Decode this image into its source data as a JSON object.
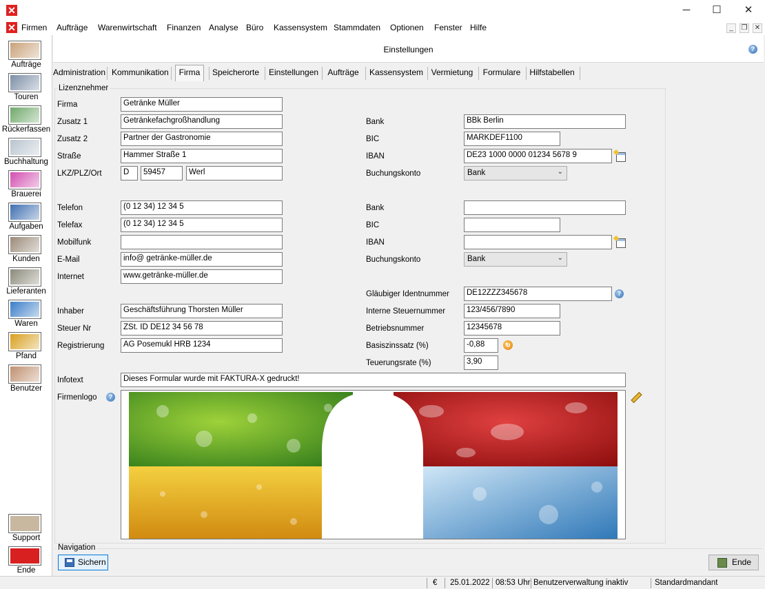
{
  "window": {
    "minimize": "─",
    "maximize": "☐",
    "close": "✕"
  },
  "menu": [
    "Firmen",
    "Aufträge",
    "Warenwirtschaft",
    "Finanzen",
    "Analyse",
    "Büro",
    "Kassensystem",
    "Stammdaten",
    "Optionen",
    "Fenster",
    "Hilfe"
  ],
  "sidebar": [
    {
      "label": "Aufträge",
      "icon": "headset-operator-icon",
      "color": "#c9a27a"
    },
    {
      "label": "Touren",
      "icon": "truck-icon",
      "color": "#7d8fa6"
    },
    {
      "label": "Rückerfassen",
      "icon": "truck-check-icon",
      "color": "#6fa86a"
    },
    {
      "label": "Buchhaltung",
      "icon": "ledger-magnifier-icon",
      "color": "#b9c4cf"
    },
    {
      "label": "Brauerei",
      "icon": "brewery-icon",
      "color": "#d24fb0"
    },
    {
      "label": "Aufgaben",
      "icon": "tasks-icon",
      "color": "#3f6fb0"
    },
    {
      "label": "Kunden",
      "icon": "customers-icon",
      "color": "#9a8a78"
    },
    {
      "label": "Lieferanten",
      "icon": "suppliers-icon",
      "color": "#8a8a7a"
    },
    {
      "label": "Waren",
      "icon": "goods-icon",
      "color": "#3a7ec8"
    },
    {
      "label": "Pfand",
      "icon": "deposit-crates-icon",
      "color": "#d8a020"
    },
    {
      "label": "Benutzer",
      "icon": "user-lock-icon",
      "color": "#c09070"
    }
  ],
  "sidebar_bottom": [
    {
      "label": "Support",
      "icon": "handshake-icon",
      "color": "#c8b8a0"
    },
    {
      "label": "Ende",
      "icon": "power-icon",
      "color": "#d82020"
    }
  ],
  "header": {
    "title": "Einstellungen"
  },
  "tabs": [
    "Administration",
    "Kommunikation",
    "Firma",
    "Speicherorte",
    "Einstellungen",
    "Aufträge",
    "Kassensystem",
    "Vermietung",
    "Formulare",
    "Hilfstabellen"
  ],
  "active_tab": "Firma",
  "group_title": "Lizenznehmer",
  "left": {
    "firma_label": "Firma",
    "firma": "Getränke Müller",
    "zusatz1_label": "Zusatz 1",
    "zusatz1": "Getränkefachgroßhandlung",
    "zusatz2_label": "Zusatz 2",
    "zusatz2": "Partner der Gastronomie",
    "strasse_label": "Straße",
    "strasse": "Hammer Straße 1",
    "ort_label": "LKZ/PLZ/Ort",
    "lkz": "D",
    "plz": "59457",
    "ort": "Werl",
    "telefon_label": "Telefon",
    "telefon": "(0 12 34) 12 34 5",
    "telefax_label": "Telefax",
    "telefax": "(0 12 34) 12 34 5",
    "mobil_label": "Mobilfunk",
    "mobil": "",
    "email_label": "E-Mail",
    "email": "info@ getränke-müller.de",
    "internet_label": "Internet",
    "internet": "www.getränke-müller.de",
    "inhaber_label": "Inhaber",
    "inhaber": "Geschäftsführung Thorsten Müller",
    "steuer_label": "Steuer Nr",
    "steuer": "ZSt. ID DE12 34 56 78",
    "registrierung_label": "Registrierung",
    "registrierung": "AG Posemukl HRB 1234",
    "infotext_label": "Infotext",
    "infotext": "Dieses Formular wurde mit FAKTURA-X gedruckt!",
    "logo_label": "Firmenlogo"
  },
  "right": {
    "bank1_label": "Bank",
    "bank1": "BBk Berlin",
    "bic1_label": "BIC",
    "bic1": "MARKDEF1100",
    "iban1_label": "IBAN",
    "iban1": "DE23 1000 0000 01234 5678 9",
    "konto1_label": "Buchungskonto",
    "konto1": "Bank",
    "bank2_label": "Bank",
    "bank2": "",
    "bic2_label": "BIC",
    "bic2": "",
    "iban2_label": "IBAN",
    "iban2": "",
    "konto2_label": "Buchungskonto",
    "konto2": "Bank",
    "glaeubiger_label": "Gläubiger Identnummer",
    "glaeubiger": "DE12ZZZ345678",
    "steuernr_label": "Interne Steuernummer",
    "steuernr": "123/456/7890",
    "betrieb_label": "Betriebsnummer",
    "betrieb": "12345678",
    "basis_label": "Basiszinssatz (%)",
    "basis": "-0,88",
    "teuerung_label": "Teuerungsrate (%)",
    "teuerung": "3,90"
  },
  "navigation": {
    "title": "Navigation",
    "save": "Sichern",
    "end": "Ende"
  },
  "status": {
    "currency": "€",
    "date": "25.01.2022",
    "time": "08:53 Uhr",
    "user_mgmt": "Benutzerverwaltung inaktiv",
    "tenant": "Standardmandant"
  },
  "colors": {
    "accent": "#0078d7",
    "close_red": "#e02020",
    "help_blue": "#3a73b8"
  }
}
